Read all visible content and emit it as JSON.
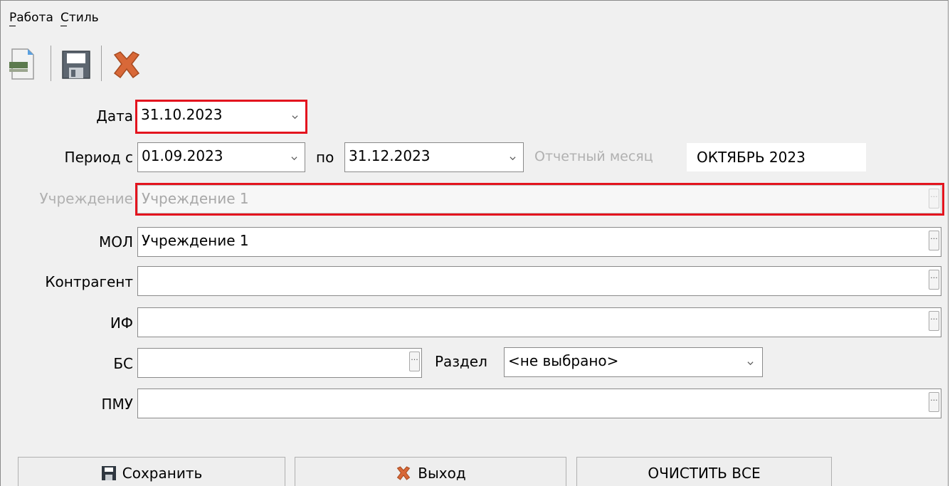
{
  "menu": {
    "work": "Работа",
    "style": "Стиль"
  },
  "toolbar": {
    "icons": [
      "new-document-icon",
      "save-disk-icon",
      "delete-x-icon"
    ]
  },
  "form": {
    "date": {
      "label": "Дата",
      "value": "31.10.2023"
    },
    "period": {
      "label_from": "Период с",
      "from": "01.09.2023",
      "label_to": "по",
      "to": "31.12.2023"
    },
    "report_month": {
      "label": "Отчетный месяц",
      "value": "ОКТЯБРЬ 2023"
    },
    "institution": {
      "label": "Учреждение",
      "value": "Учреждение 1"
    },
    "mol": {
      "label": "МОЛ",
      "value": "Учреждение 1"
    },
    "counterparty": {
      "label": "Контрагент",
      "value": ""
    },
    "if": {
      "label": "ИФ",
      "value": ""
    },
    "bs": {
      "label": "БС",
      "value": ""
    },
    "section": {
      "label": "Раздел",
      "value": "<не выбрано>"
    },
    "pmu": {
      "label": "ПМУ",
      "value": ""
    }
  },
  "buttons": {
    "save": "Сохранить",
    "exit": "Выход",
    "clear": "ОЧИСТИТЬ ВСЕ"
  },
  "colors": {
    "highlight": "#e3141e",
    "window_bg": "#f0f0f0"
  }
}
